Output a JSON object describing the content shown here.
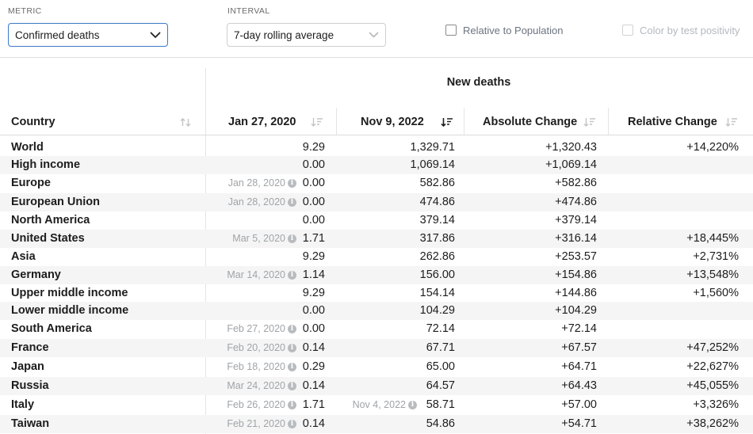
{
  "controls": {
    "metric_label": "METRIC",
    "metric_value": "Confirmed deaths",
    "interval_label": "INTERVAL",
    "interval_value": "7-day rolling average",
    "relative_population_label": "Relative to Population",
    "color_positivity_label": "Color by test positivity"
  },
  "table": {
    "group_title": "New deaths",
    "headers": {
      "country": "Country",
      "start_date": "Jan 27, 2020",
      "end_date": "Nov 9, 2022",
      "absolute": "Absolute Change",
      "relative": "Relative Change"
    },
    "rows": [
      {
        "country": "World",
        "start_note": "",
        "start": "9.29",
        "end_note": "",
        "end": "1,329.71",
        "abs": "+1,320.43",
        "rel": "+14,220%"
      },
      {
        "country": "High income",
        "start_note": "",
        "start": "0.00",
        "end_note": "",
        "end": "1,069.14",
        "abs": "+1,069.14",
        "rel": ""
      },
      {
        "country": "Europe",
        "start_note": "Jan 28, 2020",
        "start": "0.00",
        "end_note": "",
        "end": "582.86",
        "abs": "+582.86",
        "rel": ""
      },
      {
        "country": "European Union",
        "start_note": "Jan 28, 2020",
        "start": "0.00",
        "end_note": "",
        "end": "474.86",
        "abs": "+474.86",
        "rel": ""
      },
      {
        "country": "North America",
        "start_note": "",
        "start": "0.00",
        "end_note": "",
        "end": "379.14",
        "abs": "+379.14",
        "rel": ""
      },
      {
        "country": "United States",
        "start_note": "Mar 5, 2020",
        "start": "1.71",
        "end_note": "",
        "end": "317.86",
        "abs": "+316.14",
        "rel": "+18,445%"
      },
      {
        "country": "Asia",
        "start_note": "",
        "start": "9.29",
        "end_note": "",
        "end": "262.86",
        "abs": "+253.57",
        "rel": "+2,731%"
      },
      {
        "country": "Germany",
        "start_note": "Mar 14, 2020",
        "start": "1.14",
        "end_note": "",
        "end": "156.00",
        "abs": "+154.86",
        "rel": "+13,548%"
      },
      {
        "country": "Upper middle income",
        "start_note": "",
        "start": "9.29",
        "end_note": "",
        "end": "154.14",
        "abs": "+144.86",
        "rel": "+1,560%"
      },
      {
        "country": "Lower middle income",
        "start_note": "",
        "start": "0.00",
        "end_note": "",
        "end": "104.29",
        "abs": "+104.29",
        "rel": ""
      },
      {
        "country": "South America",
        "start_note": "Feb 27, 2020",
        "start": "0.00",
        "end_note": "",
        "end": "72.14",
        "abs": "+72.14",
        "rel": ""
      },
      {
        "country": "France",
        "start_note": "Feb 20, 2020",
        "start": "0.14",
        "end_note": "",
        "end": "67.71",
        "abs": "+67.57",
        "rel": "+47,252%"
      },
      {
        "country": "Japan",
        "start_note": "Feb 18, 2020",
        "start": "0.29",
        "end_note": "",
        "end": "65.00",
        "abs": "+64.71",
        "rel": "+22,627%"
      },
      {
        "country": "Russia",
        "start_note": "Mar 24, 2020",
        "start": "0.14",
        "end_note": "",
        "end": "64.57",
        "abs": "+64.43",
        "rel": "+45,055%"
      },
      {
        "country": "Italy",
        "start_note": "Feb 26, 2020",
        "start": "1.71",
        "end_note": "Nov 4, 2022",
        "end": "58.71",
        "abs": "+57.00",
        "rel": "+3,326%"
      },
      {
        "country": "Taiwan",
        "start_note": "Feb 21, 2020",
        "start": "0.14",
        "end_note": "",
        "end": "54.86",
        "abs": "+54.71",
        "rel": "+38,262%"
      }
    ]
  },
  "icons": {
    "dropdown": "chevron-down-icon",
    "sort": "sort-icon",
    "info": "info-icon"
  },
  "colors": {
    "accent_border": "#3a79c8",
    "alt_row": "#f5f5f5",
    "muted_text": "#a0a4a8"
  }
}
